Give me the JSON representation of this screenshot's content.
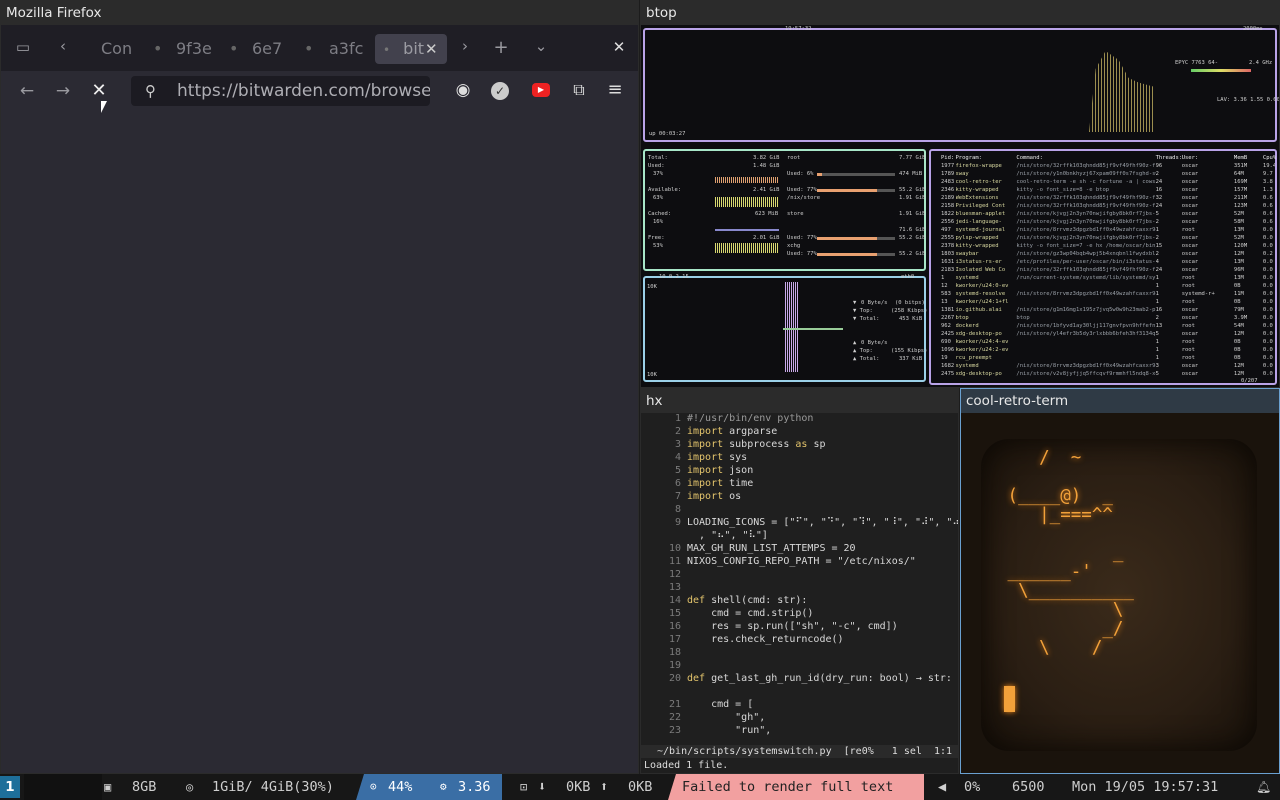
{
  "firefox": {
    "window_title": "Mozilla Firefox",
    "tabs": [
      "Con",
      "9f3e",
      "6e7",
      "a3fc",
      "bit"
    ],
    "url": "https://bitwarden.com/browse",
    "icons": [
      "tab-groups-icon",
      "chevron-left-icon",
      "close-tab-icon",
      "chevron-right-icon",
      "new-tab-icon",
      "list-tabs-icon",
      "close-window-icon",
      "back-icon",
      "forward-icon",
      "stop-icon",
      "search-icon",
      "account-icon",
      "extension-icon",
      "youtube-icon",
      "extensions-icon",
      "menu-icon"
    ]
  },
  "btop": {
    "window_title": "btop",
    "cpu_model": "EPYC 7763 64-",
    "cpu_freq": "2.4 GHz",
    "clock": "19:57:32",
    "interval": "2000ms",
    "uptime": "up 00:03:27",
    "load_avg": "LAV: 3.36 1.55 0.60",
    "mem": {
      "total": "3.82 GiB",
      "used": "1.48 GiB",
      "used_pct": "37%",
      "available": "2.41 GiB",
      "available_pct": "63%",
      "cached": "623 MiB",
      "cached_pct": "16%",
      "free": "2.01 GiB",
      "free_pct": "53%"
    },
    "disks": [
      {
        "name": "root",
        "size": "7.77 GiB",
        "used": "Used: 6%",
        "used_val": "474 MiB"
      },
      {
        "name": "/nix/store",
        "size": "1.91 GiB",
        "used": "Used: 77%",
        "used_val": "55.2 GiB"
      },
      {
        "name": "store",
        "size": "1.91 GiB",
        "used": "Used: 77%",
        "used_val": "55.2 GiB"
      },
      {
        "name": "xchg",
        "size": "71.6 GiB",
        "used": "Used: 77%",
        "used_val": "55.2 GiB"
      }
    ],
    "net": {
      "iface": "eth0",
      "addr": "10.0.2.15",
      "download": "0 Byte/s",
      "dl_top": "(0 bitps)",
      "dl_top_val": "(258 Kibps)",
      "dl_total": "453 KiB",
      "upload": "0 Byte/s",
      "up_top": "(155 Kibps)",
      "up_total": "337 KiB",
      "scale_top": "10K",
      "scale_bottom": "10K"
    },
    "proc_headers": [
      "Pid:",
      "Program:",
      "Command:",
      "Threads:",
      "User:",
      "MemB",
      "Cpu%"
    ],
    "procs": [
      [
        "1977",
        "firefox-wrappe",
        "/nix/store/32rffk103qhndd85jf9vf49fhf90z-firefox-13",
        "96",
        "oscar",
        "351M",
        "19.4"
      ],
      [
        "1789",
        "sway",
        "/nix/store/y1n0bnkhyzj67xpam09ff0s7fsghd-sway-unwra",
        "2",
        "oscar",
        "64M",
        "9.7"
      ],
      [
        "2483",
        "cool-retro-ter",
        "cool-retro-term -e sh -c fortune -a | cowsay -r; sleep",
        "24",
        "oscar",
        "169M",
        "3.8"
      ],
      [
        "2346",
        "kitty-wrapped",
        "kitty -o font_size=8 -e btop",
        "16",
        "oscar",
        "157M",
        "1.3"
      ],
      [
        "2189",
        "WebExtensions",
        "/nix/store/32rffk103qhndd85jf9vf49fhf90z-firefox-13",
        "32",
        "oscar",
        "211M",
        "0.6"
      ],
      [
        "2158",
        "Privileged Cont",
        "/nix/store/32rffk103qhndd85jf9vf49fhf90z-firefox-13",
        "24",
        "oscar",
        "123M",
        "0.6"
      ],
      [
        "1822",
        "bluesman-applet",
        "/nix/store/kjvgj2n3yn70nwjifgby8bk0rf7jbs-python3-3.",
        "5",
        "oscar",
        "52M",
        "0.6"
      ],
      [
        "2556",
        "jedi-language-",
        "/nix/store/kjvgj2n3yn70nwjifgby8bk0rf7jbs-python3-3.",
        "2",
        "oscar",
        "58M",
        "0.6"
      ],
      [
        "497",
        "systemd-journal",
        "/nix/store/8rrvmz3dpgzbd1ff0x49wzahfcaxxr9gh-systemd-25",
        "1",
        "root",
        "13M",
        "0.0"
      ],
      [
        "2555",
        "pylsp-wrapped",
        "/nix/store/kjvgj2n3yn70nwjifgby8bk0rf7jbs-python3-3.",
        "2",
        "oscar",
        "52M",
        "0.0"
      ],
      [
        "2378",
        "kitty-wrapped",
        "kitty -o font_size=7 -e hx /home/oscar/bin/scripts/sys",
        "15",
        "oscar",
        "120M",
        "0.0"
      ],
      [
        "1803",
        "swaybar",
        "/nix/store/gz3wp04bqb4wpj5b4xnqbnl1fwydxbl-sway-1.10.",
        "2",
        "oscar",
        "12M",
        "0.2"
      ],
      [
        "1631",
        "i3status-rs-er",
        "/etc/profiles/per-user/oscar/bin/i3status-rs config-bo",
        "4",
        "oscar",
        "13M",
        "0.0"
      ],
      [
        "2183",
        "Isolated Web Co",
        "/nix/store/32rffk103qhndd85jf9vf49fhf90z-firefox-13",
        "24",
        "oscar",
        "96M",
        "0.0"
      ],
      [
        "1",
        "systemd",
        "/run/current-system/systemd/lib/systemd/systemd",
        "1",
        "root",
        "13M",
        "0.0"
      ],
      [
        "12",
        "kworker/u24:0-ev",
        "",
        "1",
        "root",
        "0B",
        "0.0"
      ],
      [
        "583",
        "systemd-resolve",
        "/nix/store/8rrvmz3dpgzbd1ff0x49wzahfcaxxr9gh-systemd-25",
        "1",
        "systemd-r+",
        "11M",
        "0.0"
      ],
      [
        "13",
        "kworker/u24:1+fl",
        "",
        "1",
        "root",
        "0B",
        "0.0"
      ],
      [
        "1381",
        "io.github.alai",
        "/nix/store/g1m16mg1x195z7jvq5w0w9h23mab2-planify-4.",
        "16",
        "oscar",
        "79M",
        "0.0"
      ],
      [
        "2267",
        "btop",
        "btop",
        "2",
        "oscar",
        "3.9M",
        "0.0"
      ],
      [
        "962",
        "dockerd",
        "/nix/store/1bfyvd1ay30ljj117gnvfpvn9hffefnf-moby-27.5.",
        "13",
        "root",
        "54M",
        "0.0"
      ],
      [
        "2425",
        "xdg-desktop-po",
        "/nix/store/yl4efr3b5dy3rlxbbb6bfeh3hf3134q5-xdg-deskto",
        "5",
        "oscar",
        "12M",
        "0.0"
      ],
      [
        "690",
        "kworker/u24:4-ev",
        "",
        "1",
        "root",
        "0B",
        "0.0"
      ],
      [
        "1096",
        "kworker/u24:2-ev",
        "",
        "1",
        "root",
        "0B",
        "0.0"
      ],
      [
        "19",
        "rcu_preempt",
        "",
        "1",
        "root",
        "0B",
        "0.0"
      ],
      [
        "1682",
        "systemd",
        "/nix/store/8rrvmz3dpgzbd1ff0x49wzahfcaxxr9gh-systemd-25",
        "3",
        "oscar",
        "12M",
        "0.0"
      ],
      [
        "2475",
        "xdg-desktop-po",
        "/nix/store/v2v8jyfjjq5ffcqvf9rmmhfl5ndq8-xdg-deskto",
        "5",
        "oscar",
        "12M",
        "0.0"
      ]
    ],
    "proc_count": "0/207"
  },
  "hx": {
    "window_title": "hx",
    "lines": [
      {
        "n": "1",
        "html": "#!/usr/bin/env python"
      },
      {
        "n": "2",
        "kw": "import",
        "rest": " argparse"
      },
      {
        "n": "3",
        "kw": "import",
        "rest": " subprocess ",
        "kw2": "as",
        "rest2": " sp"
      },
      {
        "n": "4",
        "kw": "import",
        "rest": " sys"
      },
      {
        "n": "5",
        "kw": "import",
        "rest": " json"
      },
      {
        "n": "6",
        "kw": "import",
        "rest": " time"
      },
      {
        "n": "7",
        "kw": "import",
        "rest": " os"
      },
      {
        "n": "8",
        "rest": ""
      },
      {
        "n": "9",
        "rest": "LOADING_ICONS = [\"⠋\", \"⠙\", \"⠹\", \"⠸\", \"⠼\", \"⠴\""
      },
      {
        "n": "",
        "rest": "  , \"⠦\", \"⠧\"]"
      },
      {
        "n": "10",
        "rest": "MAX_GH_RUN_LIST_ATTEMPS = 20"
      },
      {
        "n": "11",
        "rest": "NIXOS_CONFIG_REPO_PATH = \"/etc/nixos/\""
      },
      {
        "n": "12",
        "rest": ""
      },
      {
        "n": "13",
        "rest": ""
      },
      {
        "n": "14",
        "kw": "def",
        "rest": " shell(cmd: str):"
      },
      {
        "n": "15",
        "rest": "    cmd = cmd.strip()"
      },
      {
        "n": "16",
        "rest": "    res = sp.run([\"sh\", \"-c\", cmd])"
      },
      {
        "n": "17",
        "rest": "    res.check_returncode()"
      },
      {
        "n": "18",
        "rest": ""
      },
      {
        "n": "19",
        "rest": ""
      },
      {
        "n": "20",
        "kw": "def",
        "rest": " get_last_gh_run_id(dry_run: bool) → str:"
      },
      {
        "n": "",
        "rest": ""
      },
      {
        "n": "21",
        "rest": "    cmd = ["
      },
      {
        "n": "22",
        "rest": "        \"gh\","
      },
      {
        "n": "23",
        "rest": "        \"run\","
      }
    ],
    "status_line": "~/bin/scripts/systemswitch.py  [re0%   1 sel  1:1",
    "message": "Loaded 1 file."
  },
  "crt": {
    "window_title": "cool-retro-term",
    "ascii": "    /  ~\n\n (____@)  _\n    |_===^^\n\n           _\n ______-'   \n  \\__________\n           \\ \n          _/\n    \\    /"
  },
  "statusbar": {
    "workspace": "1",
    "ram": "8GB",
    "mem": "1GiB/ 4GiB(30%)",
    "cpu": "44%",
    "load": "3.36",
    "down": "0KB",
    "up": "0KB",
    "error": "Failed to render full text",
    "volume": "0%",
    "brightness": "6500",
    "datetime": "Mon 19/05 19:57:31",
    "colors": {
      "error_bg": "#f2a0a0",
      "blue_seg": "#3a6ea5",
      "accent": "#1e6f9a"
    }
  }
}
